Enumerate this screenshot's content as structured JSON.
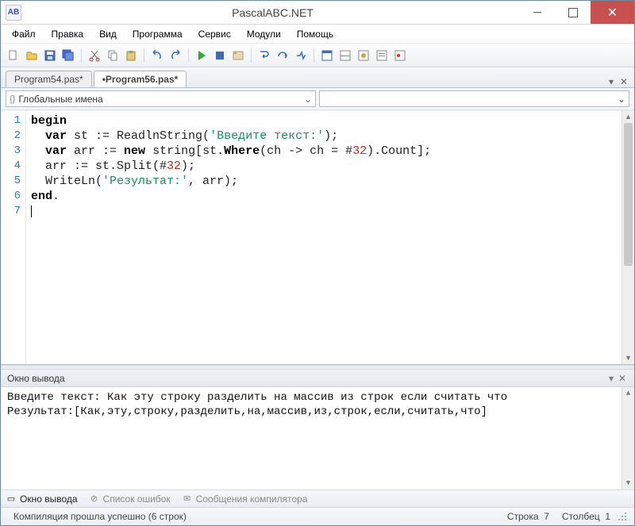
{
  "window": {
    "title": "PascalABC.NET"
  },
  "menu": {
    "items": [
      "Файл",
      "Правка",
      "Вид",
      "Программа",
      "Сервис",
      "Модули",
      "Помощь"
    ]
  },
  "tabs": {
    "items": [
      {
        "label": "Program54.pas*",
        "active": false
      },
      {
        "label": "•Program56.pas*",
        "active": true
      }
    ]
  },
  "navbar": {
    "scope": "Глобальные имена",
    "member": ""
  },
  "toolbar_icons": [
    "new-file-icon",
    "open-icon",
    "save-icon",
    "save-all-icon",
    "cut-icon",
    "copy-icon",
    "paste-icon",
    "undo-icon",
    "redo-icon",
    "run-icon",
    "stop-icon",
    "compile-icon",
    "step-into-icon",
    "step-over-icon",
    "trace-icon",
    "output-window-icon",
    "watch-icon",
    "locals-icon",
    "disasm-icon",
    "breakpoints-icon"
  ],
  "code": {
    "line_numbers": [
      "1",
      "2",
      "3",
      "4",
      "5",
      "6",
      "7"
    ],
    "lines": [
      [
        {
          "t": "begin",
          "c": "kw"
        }
      ],
      [
        {
          "t": "  "
        },
        {
          "t": "var",
          "c": "kw"
        },
        {
          "t": " st := ReadlnString("
        },
        {
          "t": "'Введите текст:'",
          "c": "str"
        },
        {
          "t": ");"
        }
      ],
      [
        {
          "t": "  "
        },
        {
          "t": "var",
          "c": "kw"
        },
        {
          "t": " arr := "
        },
        {
          "t": "new",
          "c": "kw"
        },
        {
          "t": " string[st."
        },
        {
          "t": "Where",
          "c": "mtd"
        },
        {
          "t": "(ch -> ch = #"
        },
        {
          "t": "32",
          "c": "num"
        },
        {
          "t": ").Count];"
        }
      ],
      [
        {
          "t": "  arr := st.Split(#"
        },
        {
          "t": "32",
          "c": "num"
        },
        {
          "t": ");"
        }
      ],
      [
        {
          "t": "  WriteLn("
        },
        {
          "t": "'Результат:'",
          "c": "str"
        },
        {
          "t": ", arr);"
        }
      ],
      [
        {
          "t": "end",
          "c": "kw"
        },
        {
          "t": "."
        }
      ],
      [
        {
          "t": ""
        }
      ]
    ]
  },
  "output": {
    "title": "Окно вывода",
    "lines": [
      "Введите текст: Как эту строку разделить на массив из строк если считать что",
      "Результат:[Как,эту,строку,разделить,на,массив,из,строк,если,считать,что]"
    ]
  },
  "bottom_tabs": {
    "items": [
      {
        "label": "Окно вывода",
        "active": true,
        "icon": "output-icon"
      },
      {
        "label": "Список ошибок",
        "active": false,
        "icon": "errors-icon"
      },
      {
        "label": "Сообщения компилятора",
        "active": false,
        "icon": "messages-icon"
      }
    ]
  },
  "status": {
    "message": "Компиляция прошла успешно (6 строк)",
    "line_lbl": "Строка",
    "line_val": "7",
    "col_lbl": "Столбец",
    "col_val": "1"
  }
}
